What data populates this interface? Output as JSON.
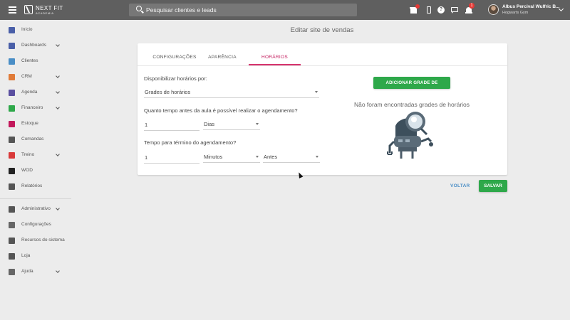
{
  "brand": {
    "name": "NEXT FIT",
    "sub": "ACADEMIA"
  },
  "search": {
    "placeholder": "Pesquisar clientes e leads"
  },
  "notifications": {
    "count": "1"
  },
  "user": {
    "name": "Albus Percival Wulfric B...",
    "gym": "Hogwarts Gym"
  },
  "sidebar": {
    "items": [
      {
        "label": "Início",
        "icon": "home-icon",
        "color": "#4a5fa8"
      },
      {
        "label": "Dashboards",
        "icon": "chart-icon",
        "color": "#4a5fa8",
        "expandable": true
      },
      {
        "label": "Clientes",
        "icon": "people-icon",
        "color": "#4a8ec6"
      },
      {
        "label": "CRM",
        "icon": "crm-icon",
        "color": "#e07b39",
        "expandable": true
      },
      {
        "label": "Agenda",
        "icon": "calendar-icon",
        "color": "#5a4fa0",
        "expandable": true
      },
      {
        "label": "Financeiro",
        "icon": "money-icon",
        "color": "#2ea84a",
        "expandable": true
      },
      {
        "label": "Estoque",
        "icon": "cart-icon",
        "color": "#c2185b"
      },
      {
        "label": "Comandas",
        "icon": "register-icon",
        "color": "#555555"
      },
      {
        "label": "Treino",
        "icon": "dumbbell-icon",
        "color": "#d93a3a",
        "expandable": true
      },
      {
        "label": "WOD",
        "icon": "kettlebell-icon",
        "color": "#222222"
      },
      {
        "label": "Relatórios",
        "icon": "report-icon",
        "color": "#555555"
      },
      {
        "label": "Administrativo",
        "icon": "admin-icon",
        "color": "#555555",
        "expandable": true
      },
      {
        "label": "Configurações",
        "icon": "gear-icon",
        "color": "#666666"
      },
      {
        "label": "Recursos do sistema",
        "icon": "toggle-icon",
        "color": "#555555"
      },
      {
        "label": "Loja",
        "icon": "store-cart-icon",
        "color": "#555555"
      },
      {
        "label": "Ajuda",
        "icon": "help-icon",
        "color": "#666666",
        "expandable": true
      }
    ]
  },
  "page": {
    "title": "Editar site de vendas"
  },
  "tabs": [
    {
      "label": "CONFIGURAÇÕES"
    },
    {
      "label": "APARÊNCIA"
    },
    {
      "label": "HORÁRIOS",
      "active": true
    }
  ],
  "form": {
    "schedule_by_label": "Disponibilizar horários por:",
    "schedule_by_value": "Grades de horários",
    "advance_label": "Quanto tempo antes da aula é possível realizar o agendamento?",
    "advance_value": "1",
    "advance_unit": "Dias",
    "end_label": "Tempo para término do agendamento?",
    "end_value": "1",
    "end_unit": "Minutos",
    "end_relation": "Antes"
  },
  "grades": {
    "add_button": "ADICIONAR GRADE DE HORÁRIOS",
    "empty_message": "Não foram encontradas grades de horários",
    "illustration": "robot-magnifier-illustration"
  },
  "actions": {
    "back": "VOLTAR",
    "save": "SALVAR"
  },
  "colors": {
    "topbar": "#5f5f5f",
    "accent_tab": "#d6336c",
    "primary_button": "#2ea84a",
    "link": "#4a8ec6"
  }
}
